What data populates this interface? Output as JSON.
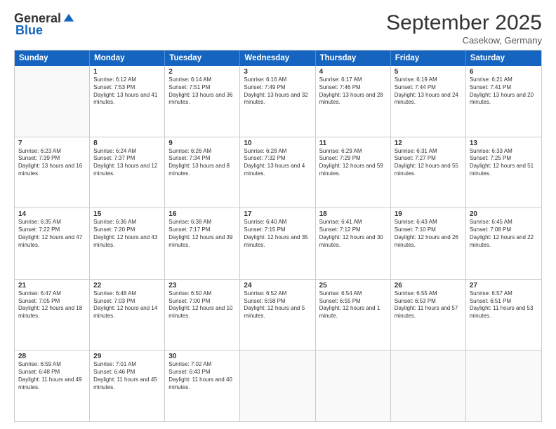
{
  "header": {
    "logo_general": "General",
    "logo_blue": "Blue",
    "month_title": "September 2025",
    "location": "Casekow, Germany"
  },
  "weekdays": [
    "Sunday",
    "Monday",
    "Tuesday",
    "Wednesday",
    "Thursday",
    "Friday",
    "Saturday"
  ],
  "rows": [
    [
      {
        "day": "",
        "sunrise": "",
        "sunset": "",
        "daylight": ""
      },
      {
        "day": "1",
        "sunrise": "Sunrise: 6:12 AM",
        "sunset": "Sunset: 7:53 PM",
        "daylight": "Daylight: 13 hours and 41 minutes."
      },
      {
        "day": "2",
        "sunrise": "Sunrise: 6:14 AM",
        "sunset": "Sunset: 7:51 PM",
        "daylight": "Daylight: 13 hours and 36 minutes."
      },
      {
        "day": "3",
        "sunrise": "Sunrise: 6:16 AM",
        "sunset": "Sunset: 7:49 PM",
        "daylight": "Daylight: 13 hours and 32 minutes."
      },
      {
        "day": "4",
        "sunrise": "Sunrise: 6:17 AM",
        "sunset": "Sunset: 7:46 PM",
        "daylight": "Daylight: 13 hours and 28 minutes."
      },
      {
        "day": "5",
        "sunrise": "Sunrise: 6:19 AM",
        "sunset": "Sunset: 7:44 PM",
        "daylight": "Daylight: 13 hours and 24 minutes."
      },
      {
        "day": "6",
        "sunrise": "Sunrise: 6:21 AM",
        "sunset": "Sunset: 7:41 PM",
        "daylight": "Daylight: 13 hours and 20 minutes."
      }
    ],
    [
      {
        "day": "7",
        "sunrise": "Sunrise: 6:23 AM",
        "sunset": "Sunset: 7:39 PM",
        "daylight": "Daylight: 13 hours and 16 minutes."
      },
      {
        "day": "8",
        "sunrise": "Sunrise: 6:24 AM",
        "sunset": "Sunset: 7:37 PM",
        "daylight": "Daylight: 13 hours and 12 minutes."
      },
      {
        "day": "9",
        "sunrise": "Sunrise: 6:26 AM",
        "sunset": "Sunset: 7:34 PM",
        "daylight": "Daylight: 13 hours and 8 minutes."
      },
      {
        "day": "10",
        "sunrise": "Sunrise: 6:28 AM",
        "sunset": "Sunset: 7:32 PM",
        "daylight": "Daylight: 13 hours and 4 minutes."
      },
      {
        "day": "11",
        "sunrise": "Sunrise: 6:29 AM",
        "sunset": "Sunset: 7:29 PM",
        "daylight": "Daylight: 12 hours and 59 minutes."
      },
      {
        "day": "12",
        "sunrise": "Sunrise: 6:31 AM",
        "sunset": "Sunset: 7:27 PM",
        "daylight": "Daylight: 12 hours and 55 minutes."
      },
      {
        "day": "13",
        "sunrise": "Sunrise: 6:33 AM",
        "sunset": "Sunset: 7:25 PM",
        "daylight": "Daylight: 12 hours and 51 minutes."
      }
    ],
    [
      {
        "day": "14",
        "sunrise": "Sunrise: 6:35 AM",
        "sunset": "Sunset: 7:22 PM",
        "daylight": "Daylight: 12 hours and 47 minutes."
      },
      {
        "day": "15",
        "sunrise": "Sunrise: 6:36 AM",
        "sunset": "Sunset: 7:20 PM",
        "daylight": "Daylight: 12 hours and 43 minutes."
      },
      {
        "day": "16",
        "sunrise": "Sunrise: 6:38 AM",
        "sunset": "Sunset: 7:17 PM",
        "daylight": "Daylight: 12 hours and 39 minutes."
      },
      {
        "day": "17",
        "sunrise": "Sunrise: 6:40 AM",
        "sunset": "Sunset: 7:15 PM",
        "daylight": "Daylight: 12 hours and 35 minutes."
      },
      {
        "day": "18",
        "sunrise": "Sunrise: 6:41 AM",
        "sunset": "Sunset: 7:12 PM",
        "daylight": "Daylight: 12 hours and 30 minutes."
      },
      {
        "day": "19",
        "sunrise": "Sunrise: 6:43 AM",
        "sunset": "Sunset: 7:10 PM",
        "daylight": "Daylight: 12 hours and 26 minutes."
      },
      {
        "day": "20",
        "sunrise": "Sunrise: 6:45 AM",
        "sunset": "Sunset: 7:08 PM",
        "daylight": "Daylight: 12 hours and 22 minutes."
      }
    ],
    [
      {
        "day": "21",
        "sunrise": "Sunrise: 6:47 AM",
        "sunset": "Sunset: 7:05 PM",
        "daylight": "Daylight: 12 hours and 18 minutes."
      },
      {
        "day": "22",
        "sunrise": "Sunrise: 6:48 AM",
        "sunset": "Sunset: 7:03 PM",
        "daylight": "Daylight: 12 hours and 14 minutes."
      },
      {
        "day": "23",
        "sunrise": "Sunrise: 6:50 AM",
        "sunset": "Sunset: 7:00 PM",
        "daylight": "Daylight: 12 hours and 10 minutes."
      },
      {
        "day": "24",
        "sunrise": "Sunrise: 6:52 AM",
        "sunset": "Sunset: 6:58 PM",
        "daylight": "Daylight: 12 hours and 5 minutes."
      },
      {
        "day": "25",
        "sunrise": "Sunrise: 6:54 AM",
        "sunset": "Sunset: 6:55 PM",
        "daylight": "Daylight: 12 hours and 1 minute."
      },
      {
        "day": "26",
        "sunrise": "Sunrise: 6:55 AM",
        "sunset": "Sunset: 6:53 PM",
        "daylight": "Daylight: 11 hours and 57 minutes."
      },
      {
        "day": "27",
        "sunrise": "Sunrise: 6:57 AM",
        "sunset": "Sunset: 6:51 PM",
        "daylight": "Daylight: 11 hours and 53 minutes."
      }
    ],
    [
      {
        "day": "28",
        "sunrise": "Sunrise: 6:59 AM",
        "sunset": "Sunset: 6:48 PM",
        "daylight": "Daylight: 11 hours and 49 minutes."
      },
      {
        "day": "29",
        "sunrise": "Sunrise: 7:01 AM",
        "sunset": "Sunset: 6:46 PM",
        "daylight": "Daylight: 11 hours and 45 minutes."
      },
      {
        "day": "30",
        "sunrise": "Sunrise: 7:02 AM",
        "sunset": "Sunset: 6:43 PM",
        "daylight": "Daylight: 11 hours and 40 minutes."
      },
      {
        "day": "",
        "sunrise": "",
        "sunset": "",
        "daylight": ""
      },
      {
        "day": "",
        "sunrise": "",
        "sunset": "",
        "daylight": ""
      },
      {
        "day": "",
        "sunrise": "",
        "sunset": "",
        "daylight": ""
      },
      {
        "day": "",
        "sunrise": "",
        "sunset": "",
        "daylight": ""
      }
    ]
  ]
}
